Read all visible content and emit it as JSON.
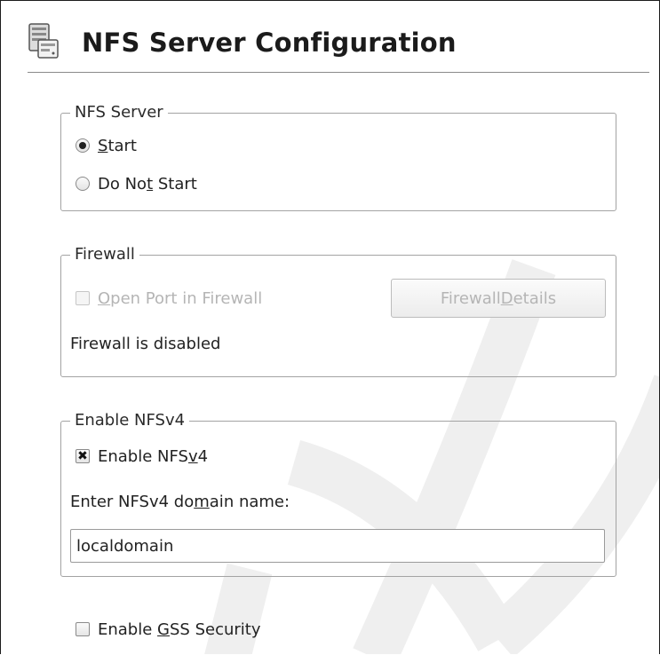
{
  "title": "NFS Server Configuration",
  "icon": "server-config-icon",
  "nfs_server": {
    "legend": "NFS Server",
    "options": [
      {
        "pre": "",
        "mn": "S",
        "post": "tart",
        "selected": true
      },
      {
        "pre": "Do No",
        "mn": "t",
        "post": " Start",
        "selected": false
      }
    ]
  },
  "firewall": {
    "legend": "Firewall",
    "open_port": {
      "pre": "",
      "mn": "O",
      "post": "pen Port in Firewall",
      "checked": false,
      "enabled": false
    },
    "details_button": {
      "pre": "Firewall ",
      "mn": "D",
      "post": "etails",
      "enabled": false
    },
    "status": "Firewall is disabled"
  },
  "nfsv4": {
    "legend": "Enable NFSv4",
    "enable": {
      "pre": "Enable NFS",
      "mn": "v",
      "post": "4",
      "checked": true
    },
    "domain_label": {
      "pre": "Enter NFSv4 do",
      "mn": "m",
      "post": "ain name:"
    },
    "domain_value": "localdomain"
  },
  "gss": {
    "pre": "Enable ",
    "mn": "G",
    "post": "SS Security",
    "checked": false
  },
  "colors": {
    "frame": "#1c1c1c",
    "group_border": "#a3a3a3",
    "disabled_text": "#b5b5b5",
    "watermark": "#f0f0f0"
  }
}
